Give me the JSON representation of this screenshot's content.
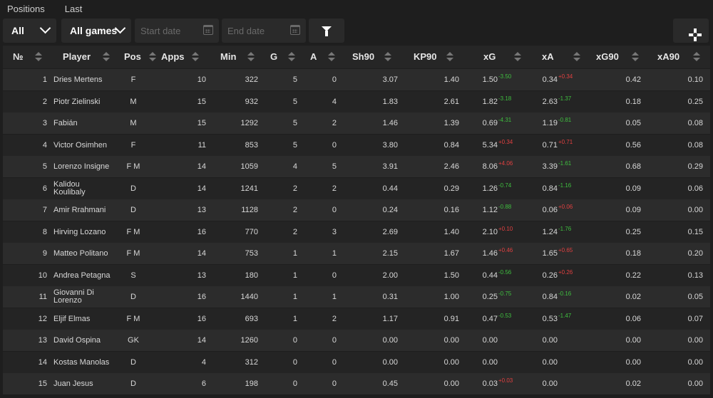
{
  "tabs": [
    "Positions",
    "Last"
  ],
  "toolbar": {
    "position_filter": "All",
    "games_filter": "All games",
    "start_date_placeholder": "Start date",
    "end_date_placeholder": "End date"
  },
  "columns": [
    "№",
    "Player",
    "Pos",
    "Apps",
    "Min",
    "G",
    "A",
    "Sh90",
    "KP90",
    "xG",
    "xA",
    "xG90",
    "xA90"
  ],
  "rows": [
    {
      "n": "1",
      "player": "Dries Mertens",
      "pos": "F",
      "apps": "10",
      "min": "322",
      "g": "5",
      "a": "0",
      "sh90": "3.07",
      "kp90": "1.40",
      "xg": "1.50",
      "xg_d": "-3.50",
      "xa": "0.34",
      "xa_d": "+0.34",
      "xg90": "0.42",
      "xa90": "0.10"
    },
    {
      "n": "2",
      "player": "Piotr Zielinski",
      "pos": "M",
      "apps": "15",
      "min": "932",
      "g": "5",
      "a": "4",
      "sh90": "1.83",
      "kp90": "2.61",
      "xg": "1.82",
      "xg_d": "-3.18",
      "xa": "2.63",
      "xa_d": "-1.37",
      "xg90": "0.18",
      "xa90": "0.25"
    },
    {
      "n": "3",
      "player": "Fabián",
      "pos": "M",
      "apps": "15",
      "min": "1292",
      "g": "5",
      "a": "2",
      "sh90": "1.46",
      "kp90": "1.39",
      "xg": "0.69",
      "xg_d": "-4.31",
      "xa": "1.19",
      "xa_d": "-0.81",
      "xg90": "0.05",
      "xa90": "0.08"
    },
    {
      "n": "4",
      "player": "Victor Osimhen",
      "pos": "F",
      "apps": "11",
      "min": "853",
      "g": "5",
      "a": "0",
      "sh90": "3.80",
      "kp90": "0.84",
      "xg": "5.34",
      "xg_d": "+0.34",
      "xa": "0.71",
      "xa_d": "+0.71",
      "xg90": "0.56",
      "xa90": "0.08"
    },
    {
      "n": "5",
      "player": "Lorenzo Insigne",
      "pos": "F M",
      "apps": "14",
      "min": "1059",
      "g": "4",
      "a": "5",
      "sh90": "3.91",
      "kp90": "2.46",
      "xg": "8.06",
      "xg_d": "+4.06",
      "xa": "3.39",
      "xa_d": "-1.61",
      "xg90": "0.68",
      "xa90": "0.29"
    },
    {
      "n": "6",
      "player": "Kalidou Koulibaly",
      "pos": "D",
      "apps": "14",
      "min": "1241",
      "g": "2",
      "a": "2",
      "sh90": "0.44",
      "kp90": "0.29",
      "xg": "1.26",
      "xg_d": "-0.74",
      "xa": "0.84",
      "xa_d": "-1.16",
      "xg90": "0.09",
      "xa90": "0.06"
    },
    {
      "n": "7",
      "player": "Amir Rrahmani",
      "pos": "D",
      "apps": "13",
      "min": "1128",
      "g": "2",
      "a": "0",
      "sh90": "0.24",
      "kp90": "0.16",
      "xg": "1.12",
      "xg_d": "-0.88",
      "xa": "0.06",
      "xa_d": "+0.06",
      "xg90": "0.09",
      "xa90": "0.00"
    },
    {
      "n": "8",
      "player": "Hirving Lozano",
      "pos": "F M",
      "apps": "16",
      "min": "770",
      "g": "2",
      "a": "3",
      "sh90": "2.69",
      "kp90": "1.40",
      "xg": "2.10",
      "xg_d": "+0.10",
      "xa": "1.24",
      "xa_d": "-1.76",
      "xg90": "0.25",
      "xa90": "0.15"
    },
    {
      "n": "9",
      "player": "Matteo Politano",
      "pos": "F M",
      "apps": "14",
      "min": "753",
      "g": "1",
      "a": "1",
      "sh90": "2.15",
      "kp90": "1.67",
      "xg": "1.46",
      "xg_d": "+0.46",
      "xa": "1.65",
      "xa_d": "+0.65",
      "xg90": "0.18",
      "xa90": "0.20"
    },
    {
      "n": "10",
      "player": "Andrea Petagna",
      "pos": "S",
      "apps": "13",
      "min": "180",
      "g": "1",
      "a": "0",
      "sh90": "2.00",
      "kp90": "1.50",
      "xg": "0.44",
      "xg_d": "-0.56",
      "xa": "0.26",
      "xa_d": "+0.26",
      "xg90": "0.22",
      "xa90": "0.13"
    },
    {
      "n": "11",
      "player": "Giovanni Di Lorenzo",
      "pos": "D",
      "apps": "16",
      "min": "1440",
      "g": "1",
      "a": "1",
      "sh90": "0.31",
      "kp90": "1.00",
      "xg": "0.25",
      "xg_d": "-0.75",
      "xa": "0.84",
      "xa_d": "-0.16",
      "xg90": "0.02",
      "xa90": "0.05"
    },
    {
      "n": "12",
      "player": "Eljif Elmas",
      "pos": "F M",
      "apps": "16",
      "min": "693",
      "g": "1",
      "a": "2",
      "sh90": "1.17",
      "kp90": "0.91",
      "xg": "0.47",
      "xg_d": "-0.53",
      "xa": "0.53",
      "xa_d": "-1.47",
      "xg90": "0.06",
      "xa90": "0.07"
    },
    {
      "n": "13",
      "player": "David Ospina",
      "pos": "GK",
      "apps": "14",
      "min": "1260",
      "g": "0",
      "a": "0",
      "sh90": "0.00",
      "kp90": "0.00",
      "xg": "0.00",
      "xg_d": "",
      "xa": "0.00",
      "xa_d": "",
      "xg90": "0.00",
      "xa90": "0.00"
    },
    {
      "n": "14",
      "player": "Kostas Manolas",
      "pos": "D",
      "apps": "4",
      "min": "312",
      "g": "0",
      "a": "0",
      "sh90": "0.00",
      "kp90": "0.00",
      "xg": "0.00",
      "xg_d": "",
      "xa": "0.00",
      "xa_d": "",
      "xg90": "0.00",
      "xa90": "0.00"
    },
    {
      "n": "15",
      "player": "Juan Jesus",
      "pos": "D",
      "apps": "6",
      "min": "198",
      "g": "0",
      "a": "0",
      "sh90": "0.45",
      "kp90": "0.00",
      "xg": "0.03",
      "xg_d": "+0.03",
      "xa": "0.00",
      "xa_d": "",
      "xg90": "0.02",
      "xa90": "0.00"
    }
  ],
  "colors": {
    "positive_delta": "#3fbf3f",
    "negative_delta": "#e04040",
    "background": "#1e1e1e"
  },
  "icons": {
    "filter": "funnel-icon",
    "settings": "gear-icon",
    "calendar": "calendar-icon",
    "dropdown": "chevron-down-icon"
  }
}
